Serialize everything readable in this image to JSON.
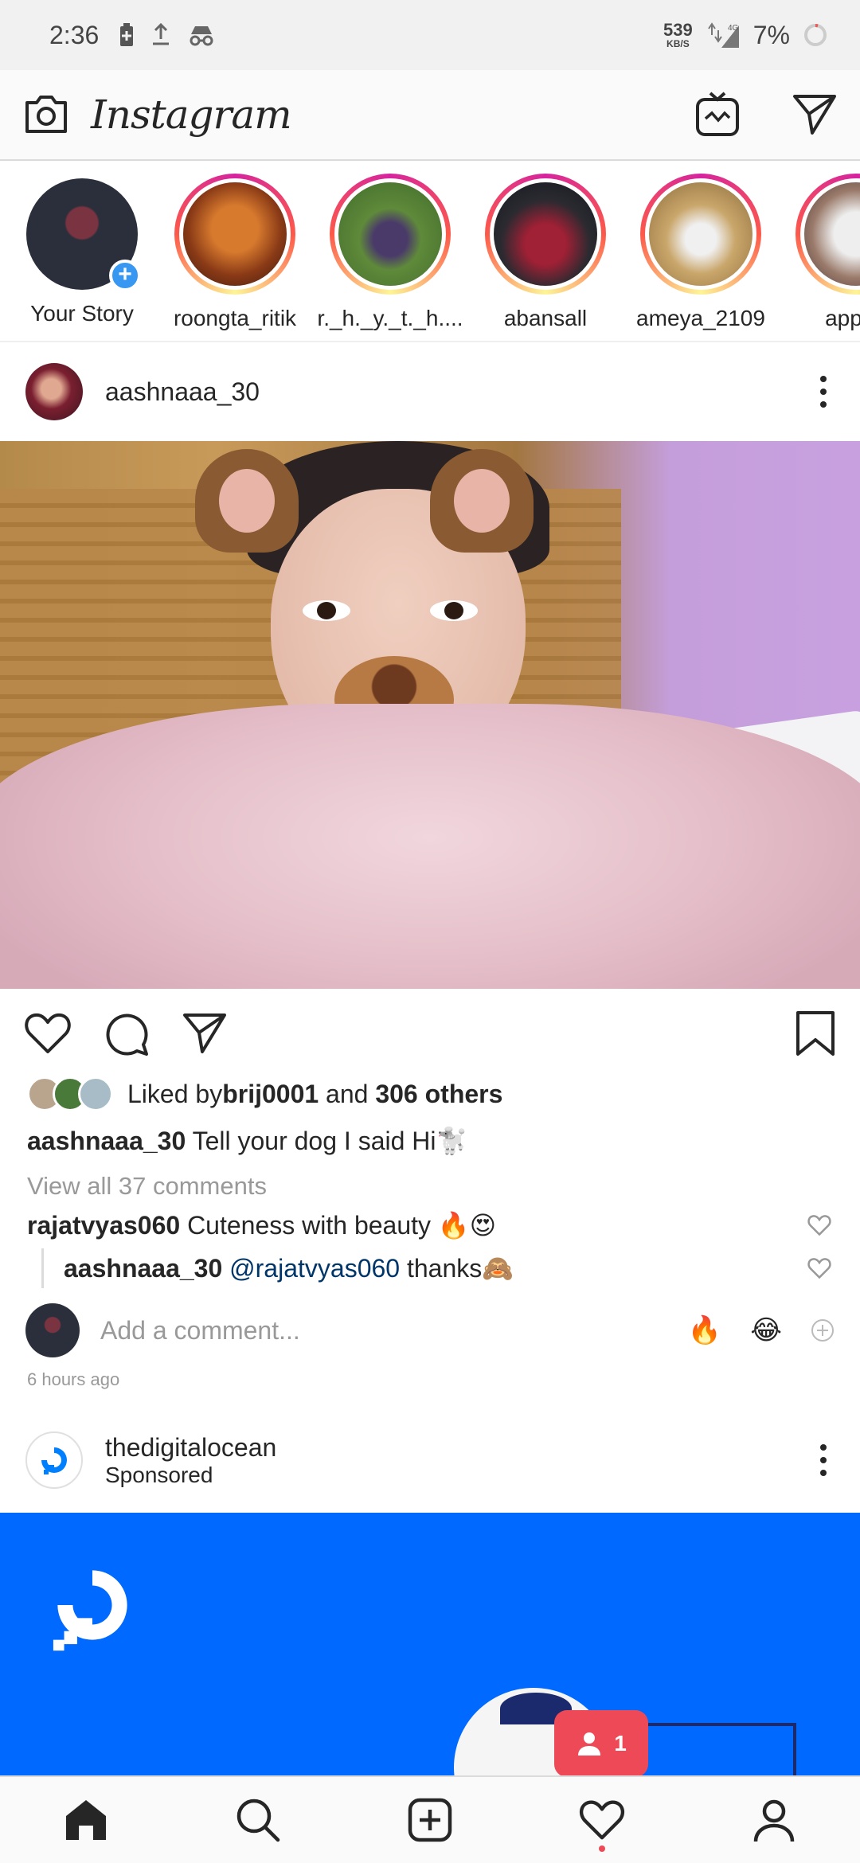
{
  "status_bar": {
    "time": "2:36",
    "network_speed": "539",
    "network_speed_unit": "KB/S",
    "network_type": "4G",
    "battery": "7%"
  },
  "header": {
    "app_name": "Instagram"
  },
  "stories": [
    {
      "name": "Your Story",
      "is_own": true
    },
    {
      "name": "roongta_ritik"
    },
    {
      "name": "r._h._y._t._h...."
    },
    {
      "name": "abansall"
    },
    {
      "name": "ameya_2109"
    },
    {
      "name": "appu_"
    }
  ],
  "post": {
    "username": "aashnaaa_30",
    "liked_by_prefix": "Liked by ",
    "liked_by_user": "brij0001",
    "liked_by_and": " and ",
    "liked_by_others": "306 others",
    "caption_user": "aashnaaa_30",
    "caption_text": " Tell your dog I said Hi🐩",
    "view_all_comments": "View all 37 comments",
    "comments": [
      {
        "user": "rajatvyas060",
        "text": " Cuteness with beauty 🔥😍"
      },
      {
        "user": "aashnaaa_30",
        "mention": " @rajatvyas060",
        "text": " thanks🙈"
      }
    ],
    "add_comment_placeholder": "Add a comment...",
    "quick_emojis": [
      "🔥",
      "😂"
    ],
    "time_ago": "6 hours ago"
  },
  "sponsored_post": {
    "username": "thedigitalocean",
    "label": "Sponsored"
  },
  "notification": {
    "count": "1"
  },
  "colors": {
    "like_red": "#ed4956",
    "link_blue": "#003569",
    "ad_blue": "#0069ff",
    "story_badge_blue": "#3897f0"
  }
}
